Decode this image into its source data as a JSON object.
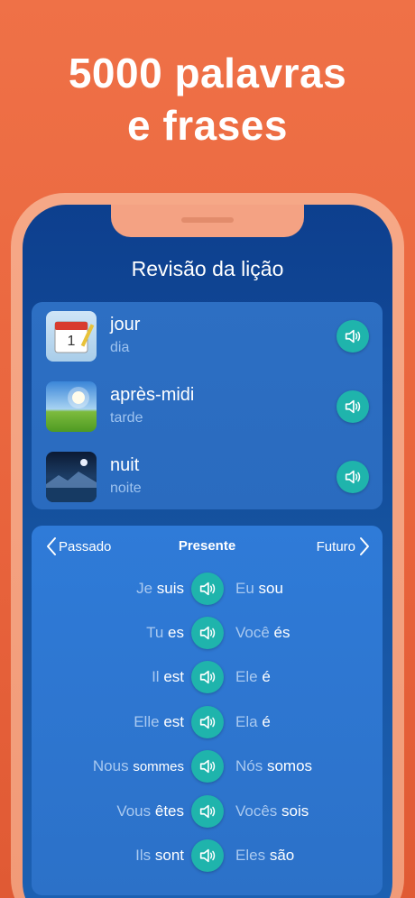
{
  "headline": {
    "line1": "5000 palavras",
    "line2": "e frases"
  },
  "screen": {
    "title": "Revisão da lição"
  },
  "words": [
    {
      "main": "jour",
      "translation": "dia",
      "icon": "calendar-icon"
    },
    {
      "main": "après-midi",
      "translation": "tarde",
      "icon": "afternoon-landscape-icon"
    },
    {
      "main": "nuit",
      "translation": "noite",
      "icon": "night-landscape-icon"
    }
  ],
  "tense_nav": {
    "previous": "Passado",
    "current": "Presente",
    "next": "Futuro"
  },
  "conjugations": [
    {
      "fr_pronoun": "Je",
      "fr_verb": "suis",
      "pt_pronoun": "Eu",
      "pt_verb": "sou"
    },
    {
      "fr_pronoun": "Tu",
      "fr_verb": "es",
      "pt_pronoun": "Você",
      "pt_verb": "és"
    },
    {
      "fr_pronoun": "Il",
      "fr_verb": "est",
      "pt_pronoun": "Ele",
      "pt_verb": "é"
    },
    {
      "fr_pronoun": "Elle",
      "fr_verb": "est",
      "pt_pronoun": "Ela",
      "pt_verb": "é"
    },
    {
      "fr_pronoun": "Nous",
      "fr_verb": "sommes",
      "pt_pronoun": "Nós",
      "pt_verb": "somos"
    },
    {
      "fr_pronoun": "Vous",
      "fr_verb": "êtes",
      "pt_pronoun": "Vocês",
      "pt_verb": "sois"
    },
    {
      "fr_pronoun": "Ils",
      "fr_verb": "sont",
      "pt_pronoun": "Eles",
      "pt_verb": "são"
    }
  ],
  "colors": {
    "background": "#ef7147",
    "speaker_button": "#1fb4ac",
    "screen": "#15529f"
  }
}
